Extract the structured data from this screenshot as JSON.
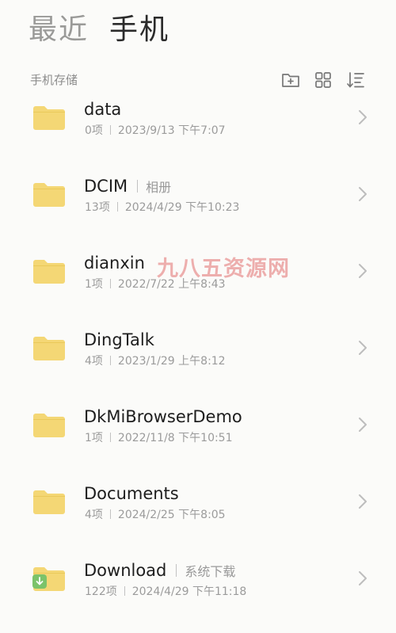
{
  "header": {
    "tab_recent": "最近",
    "tab_phone": "手机"
  },
  "toolbar": {
    "label": "手机存储",
    "icons": [
      "new-folder-icon",
      "grid-view-icon",
      "sort-icon"
    ]
  },
  "folders": [
    {
      "name": "data",
      "alias": "",
      "count": "0项",
      "date": "2023/9/13 下午7:07"
    },
    {
      "name": "DCIM",
      "alias": "相册",
      "count": "13项",
      "date": "2024/4/29 下午10:23"
    },
    {
      "name": "dianxin",
      "alias": "",
      "count": "1项",
      "date": "2022/7/22 上午8:43"
    },
    {
      "name": "DingTalk",
      "alias": "",
      "count": "4项",
      "date": "2023/1/29 上午8:12"
    },
    {
      "name": "DkMiBrowserDemo",
      "alias": "",
      "count": "1项",
      "date": "2022/11/8 下午10:51"
    },
    {
      "name": "Documents",
      "alias": "",
      "count": "4项",
      "date": "2024/2/25 下午8:05"
    },
    {
      "name": "Download",
      "alias": "系统下载",
      "count": "122项",
      "date": "2024/4/29 下午11:18"
    }
  ],
  "watermark": "九八五资源网",
  "colors": {
    "folder": "#f4d775",
    "background": "#fbfbf9",
    "download_badge": "#7cc36a"
  }
}
